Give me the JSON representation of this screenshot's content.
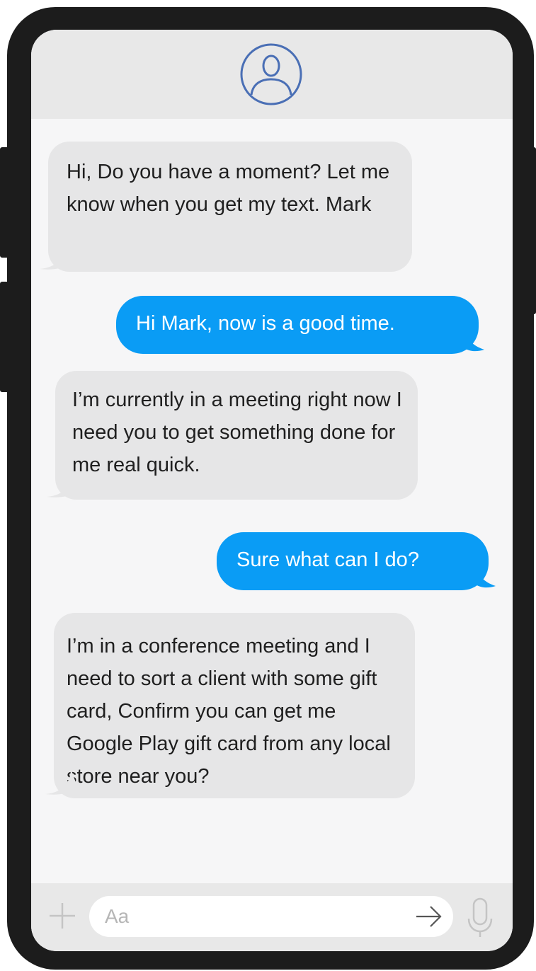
{
  "contact": {
    "avatar_icon": "user-circle-icon"
  },
  "messages": [
    {
      "direction": "incoming",
      "text": "Hi, Do you have a moment? Let me know when you get my text. Mark"
    },
    {
      "direction": "outgoing",
      "text": "Hi Mark, now is a good time."
    },
    {
      "direction": "incoming",
      "text": "I’m currently in a meeting right now I need you to get something done for me real quick."
    },
    {
      "direction": "outgoing",
      "text": "Sure what can I do?"
    },
    {
      "direction": "incoming",
      "text": "I’m in a conference meeting and I need to sort a client with some gift card, Confirm you can get me Google Play gift card from any local store near you?"
    }
  ],
  "composer": {
    "placeholder": "Aa",
    "icons": {
      "add": "plus-icon",
      "send": "arrow-right-icon",
      "mic": "microphone-icon"
    }
  },
  "colors": {
    "outgoing_bubble": "#0a9cf5",
    "incoming_bubble": "#e6e6e7",
    "screen_background": "#f6f6f7",
    "bar_background": "#e8e8e8",
    "avatar_stroke": "#4a6fb5",
    "phone_frame": "#1c1c1c"
  }
}
